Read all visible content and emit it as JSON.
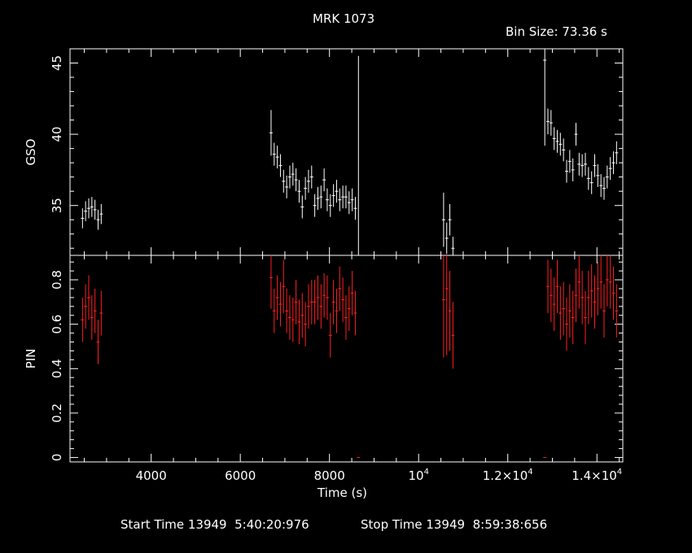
{
  "title": "MRK 1073",
  "bin_size": "Bin Size: 73.36 s",
  "start_label": "Start Time 13949  5:40:20:976",
  "stop_label": "Stop Time 13949  8:59:38:656",
  "colors": {
    "gso": "#ffffff",
    "pin": "#ff2020",
    "axes": "#ffffff",
    "background": "#000000"
  },
  "chart_data": {
    "type": "scatter",
    "xlabel": "Time (s)",
    "xlim": [
      2180,
      14580
    ],
    "x_tick_labels": [
      "4000",
      "6000",
      "8000",
      "10^4",
      "1.2×10^4",
      "1.4×10^4"
    ],
    "x_tick_values": [
      4000,
      6000,
      8000,
      10000,
      12000,
      14000
    ],
    "panels": [
      {
        "name": "GSO",
        "ylabel": "GSO",
        "ylim": [
          31.5,
          46
        ],
        "y_tick_labels": [
          "35",
          "40",
          "45"
        ],
        "y_tick_values": [
          35,
          40,
          45
        ],
        "x": [
          2460,
          2530,
          2600,
          2670,
          2740,
          2810,
          2880,
          6690,
          6760,
          6830,
          6900,
          6970,
          7040,
          7110,
          7180,
          7250,
          7320,
          7390,
          7460,
          7530,
          7600,
          7670,
          7740,
          7810,
          7880,
          7950,
          8020,
          8090,
          8160,
          8230,
          8300,
          8370,
          8440,
          8510,
          8580,
          8650,
          10560,
          10630,
          10700,
          10770,
          12830,
          12900,
          12970,
          13040,
          13110,
          13180,
          13250,
          13320,
          13390,
          13460,
          13530,
          13600,
          13670,
          13740,
          13810,
          13880,
          13950,
          14020,
          14090,
          14160,
          14230,
          14300,
          14370,
          14440
        ],
        "y": [
          34.1,
          34.6,
          34.8,
          34.9,
          34.7,
          34.0,
          34.4,
          40.1,
          38.6,
          38.4,
          37.8,
          36.7,
          36.3,
          37.0,
          37.2,
          36.8,
          36.0,
          34.9,
          36.2,
          36.7,
          37.0,
          35.0,
          35.5,
          35.6,
          36.8,
          35.4,
          35.0,
          35.7,
          36.0,
          35.4,
          35.6,
          35.6,
          35.2,
          35.4,
          34.8,
          31.5,
          34.0,
          32.7,
          34.0,
          32.0,
          45.2,
          40.9,
          40.8,
          39.7,
          39.5,
          39.3,
          38.9,
          37.4,
          38.1,
          37.5,
          40.0,
          37.9,
          37.8,
          37.9,
          36.9,
          36.6,
          37.8,
          37.1,
          36.4,
          36.2,
          37.0,
          37.6,
          38.0,
          38.7
        ],
        "yerr": [
          0.7,
          0.7,
          0.7,
          0.7,
          0.7,
          0.7,
          0.7,
          1.6,
          0.8,
          0.8,
          0.8,
          0.8,
          0.8,
          0.8,
          0.8,
          0.8,
          0.8,
          0.8,
          0.8,
          0.8,
          0.8,
          0.8,
          0.8,
          0.8,
          0.8,
          0.8,
          0.8,
          0.8,
          0.8,
          0.8,
          0.8,
          0.8,
          0.8,
          0.8,
          0.8,
          14.0,
          1.9,
          1.1,
          1.1,
          0.8,
          6.0,
          0.9,
          0.9,
          0.8,
          0.8,
          0.8,
          0.8,
          0.8,
          0.8,
          0.8,
          0.8,
          0.8,
          0.8,
          0.8,
          0.8,
          0.8,
          0.8,
          0.8,
          0.8,
          0.8,
          0.8,
          0.8,
          0.8,
          0.8
        ]
      },
      {
        "name": "PIN",
        "ylabel": "PIN",
        "ylim": [
          -0.02,
          0.91
        ],
        "y_tick_labels": [
          "0",
          "0.2",
          "0.4",
          "0.6",
          "0.8"
        ],
        "y_tick_values": [
          0,
          0.2,
          0.4,
          0.6,
          0.8
        ],
        "x": [
          2460,
          2530,
          2600,
          2670,
          2740,
          2810,
          2880,
          6690,
          6760,
          6830,
          6900,
          6970,
          7040,
          7110,
          7180,
          7250,
          7320,
          7390,
          7460,
          7530,
          7600,
          7670,
          7740,
          7810,
          7880,
          7950,
          8020,
          8090,
          8160,
          8230,
          8300,
          8370,
          8440,
          8510,
          8580,
          8650,
          10560,
          10630,
          10700,
          10770,
          12830,
          12900,
          12970,
          13040,
          13110,
          13180,
          13250,
          13320,
          13390,
          13460,
          13530,
          13600,
          13670,
          13740,
          13810,
          13880,
          13950,
          14020,
          14090,
          14160,
          14230,
          14300,
          14370,
          14440
        ],
        "y": [
          0.62,
          0.68,
          0.72,
          0.63,
          0.66,
          0.52,
          0.65,
          0.81,
          0.66,
          0.72,
          0.69,
          0.77,
          0.66,
          0.63,
          0.62,
          0.7,
          0.61,
          0.64,
          0.6,
          0.68,
          0.7,
          0.7,
          0.72,
          0.68,
          0.73,
          0.72,
          0.55,
          0.7,
          0.66,
          0.76,
          0.71,
          0.63,
          0.67,
          0.74,
          0.65,
          0.0,
          0.71,
          0.76,
          0.66,
          0.55,
          0.0,
          0.77,
          0.73,
          0.69,
          0.77,
          0.65,
          0.67,
          0.6,
          0.66,
          0.63,
          0.73,
          0.79,
          0.72,
          0.63,
          0.72,
          0.75,
          0.7,
          0.76,
          0.79,
          0.66,
          0.8,
          0.79,
          0.74,
          0.66
        ],
        "yerr": [
          0.1,
          0.1,
          0.1,
          0.1,
          0.1,
          0.1,
          0.1,
          0.14,
          0.1,
          0.1,
          0.1,
          0.12,
          0.1,
          0.1,
          0.1,
          0.1,
          0.1,
          0.1,
          0.1,
          0.1,
          0.1,
          0.1,
          0.1,
          0.1,
          0.1,
          0.1,
          0.1,
          0.1,
          0.1,
          0.1,
          0.1,
          0.1,
          0.1,
          0.1,
          0.1,
          0.0,
          0.26,
          0.3,
          0.18,
          0.15,
          0.0,
          0.12,
          0.12,
          0.12,
          0.12,
          0.12,
          0.12,
          0.12,
          0.12,
          0.12,
          0.12,
          0.12,
          0.12,
          0.12,
          0.12,
          0.12,
          0.12,
          0.12,
          0.12,
          0.12,
          0.12,
          0.12,
          0.12,
          0.12
        ]
      }
    ]
  }
}
